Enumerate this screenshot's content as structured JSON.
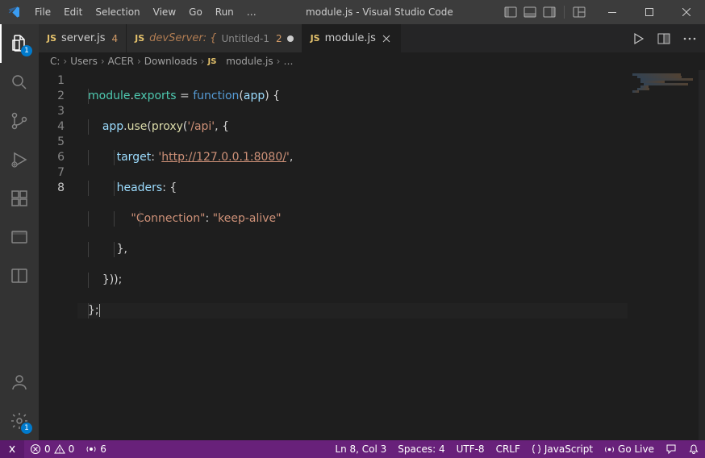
{
  "title": "module.js - Visual Studio Code",
  "menu": [
    "File",
    "Edit",
    "Selection",
    "View",
    "Go",
    "Run",
    "…"
  ],
  "tabs": [
    {
      "icon": "JS",
      "name": "server.js",
      "problems": "4",
      "italic": false,
      "dirty": false,
      "active": false
    },
    {
      "icon": "JS",
      "name": "devServer: {",
      "suffix": "Untitled-1",
      "problems": "2",
      "italic": true,
      "dirty": true,
      "active": false
    },
    {
      "icon": "JS",
      "name": "module.js",
      "italic": false,
      "active": true,
      "closable": true
    }
  ],
  "breadcrumbs": [
    "C:",
    "Users",
    "ACER",
    "Downloads",
    "module.js",
    "…"
  ],
  "code": {
    "lines": [
      "module.exports = function(app) {",
      "    app.use(proxy('/api', {",
      "        target: 'http://127.0.0.1:8080/',",
      "        headers: {",
      "            \"Connection\": \"keep-alive\"",
      "        },",
      "    }));",
      "};"
    ],
    "active_line": 8
  },
  "status": {
    "errors": "0",
    "warnings": "0",
    "ports": "6",
    "cursor": "Ln 8, Col 3",
    "spaces": "Spaces: 4",
    "encoding": "UTF-8",
    "eol": "CRLF",
    "lang": "JavaScript",
    "golive": "Go Live"
  },
  "activity_badge": "1",
  "settings_badge": "1"
}
